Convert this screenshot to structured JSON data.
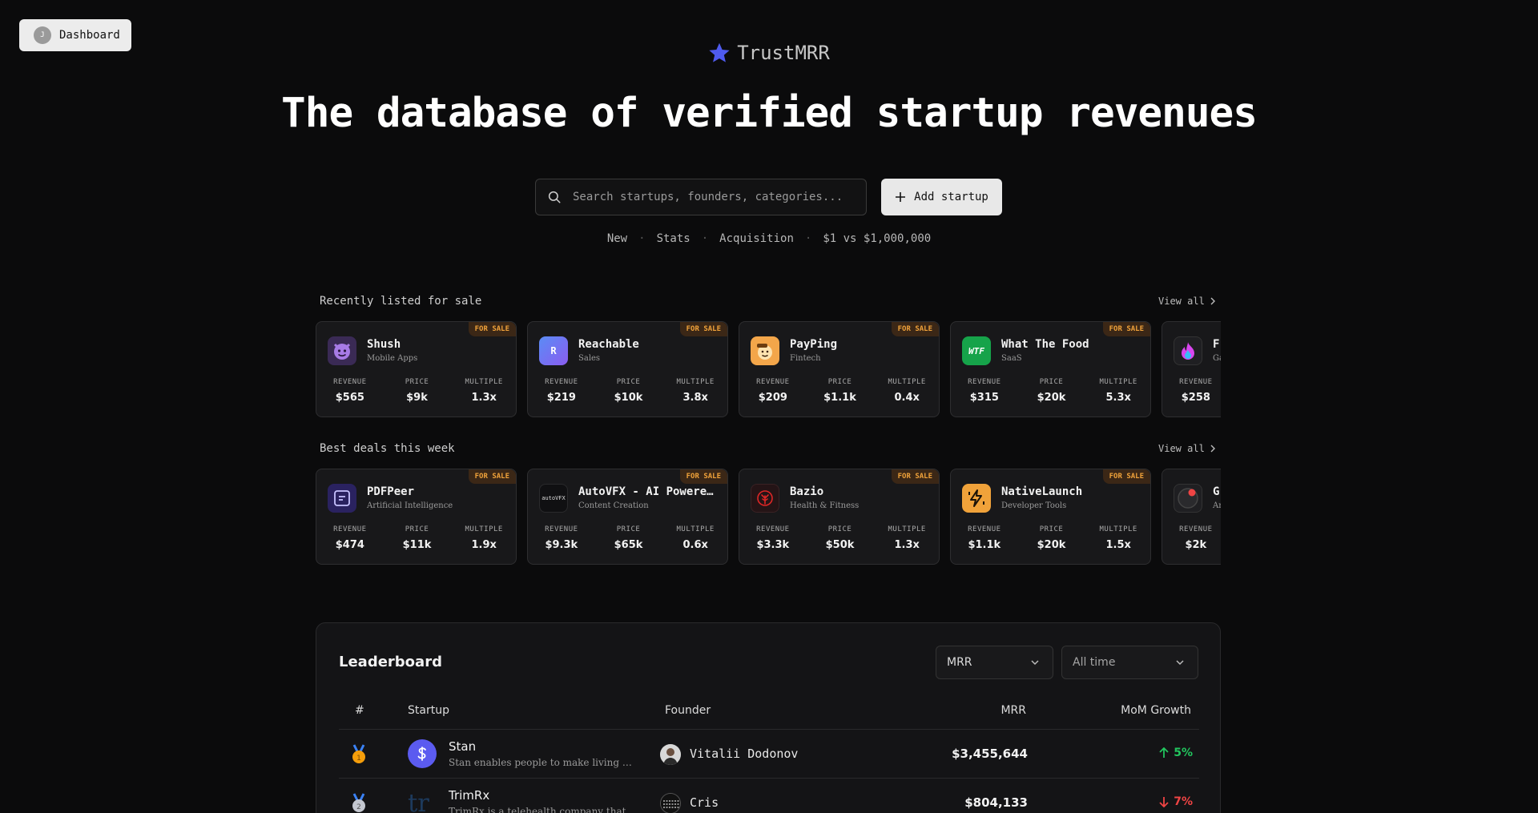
{
  "nav": {
    "dashboard_label": "Dashboard",
    "avatar_initial": "J"
  },
  "brand": {
    "name": "TrustMRR",
    "accent": "#4f5bef"
  },
  "hero": {
    "title": "The database of verified startup revenues"
  },
  "search": {
    "placeholder": "Search startups, founders, categories..."
  },
  "add_startup_label": "Add startup",
  "links": [
    "New",
    "Stats",
    "Acquisition",
    "$1 vs $1,000,000"
  ],
  "recent": {
    "title": "Recently listed for sale",
    "view_all": "View all",
    "cards": [
      {
        "name": "Shush",
        "category": "Mobile Apps",
        "badge": "FOR SALE",
        "revenue": "$565",
        "price": "$9k",
        "multiple": "1.3x",
        "logo_icon": "devil-emoji-icon",
        "logo_color": "#3a2a55"
      },
      {
        "name": "Reachable",
        "category": "Sales",
        "badge": "FOR SALE",
        "revenue": "$219",
        "price": "$10k",
        "multiple": "3.8x",
        "logo_text": "R",
        "logo_color": "#6d6cf2"
      },
      {
        "name": "PayPing",
        "category": "Fintech",
        "badge": "FOR SALE",
        "revenue": "$209",
        "price": "$1.1k",
        "multiple": "0.4x",
        "logo_icon": "saluting-face-icon",
        "logo_color": "#f3a64a"
      },
      {
        "name": "What The Food",
        "category": "SaaS",
        "badge": "FOR SALE",
        "revenue": "$315",
        "price": "$20k",
        "multiple": "5.3x",
        "logo_text": "WTF",
        "logo_color": "#16a34a"
      },
      {
        "name": "F",
        "category": "Ga",
        "badge": "",
        "revenue": "$258",
        "price": "",
        "multiple": "",
        "logo_icon": "flame-icon",
        "logo_color": "#1f1f22"
      }
    ]
  },
  "deals": {
    "title": "Best deals this week",
    "view_all": "View all",
    "cards": [
      {
        "name": "PDFPeer",
        "category": "Artificial Intelligence",
        "badge": "FOR SALE",
        "revenue": "$474",
        "price": "$11k",
        "multiple": "1.9x",
        "logo_icon": "document-icon",
        "logo_color": "#2a2260"
      },
      {
        "name": "AutoVFX - AI Powered…",
        "category": "Content Creation",
        "badge": "FOR SALE",
        "revenue": "$9.3k",
        "price": "$65k",
        "multiple": "0.6x",
        "logo_text": "autoVFX",
        "logo_color": "#101012"
      },
      {
        "name": "Bazio",
        "category": "Health & Fitness",
        "badge": "FOR SALE",
        "revenue": "$3.3k",
        "price": "$50k",
        "multiple": "1.3x",
        "logo_icon": "leaf-icon",
        "logo_color": "#241416"
      },
      {
        "name": "NativeLaunch",
        "category": "Developer Tools",
        "badge": "FOR SALE",
        "revenue": "$1.1k",
        "price": "$20k",
        "multiple": "1.5x",
        "logo_icon": "lightning-icon",
        "logo_color": "#f0a23a"
      },
      {
        "name": "G",
        "category": "Ar",
        "badge": "",
        "revenue": "$2k",
        "price": "",
        "multiple": "",
        "logo_icon": "record-icon",
        "logo_color": "#1f1f22"
      }
    ]
  },
  "metric_labels": {
    "revenue": "REVENUE",
    "price": "PRICE",
    "multiple": "MULTIPLE"
  },
  "leaderboard": {
    "title": "Leaderboard",
    "metric_select": "MRR",
    "period_select": "All time",
    "columns": {
      "rank": "#",
      "startup": "Startup",
      "founder": "Founder",
      "mrr": "MRR",
      "growth": "MoM Growth"
    },
    "rows": [
      {
        "name": "Stan",
        "desc": "Stan enables people to make living …",
        "founder": "Vitalii Dodonov",
        "mrr": "$3,455,644",
        "growth": "5%",
        "direction": "up",
        "medal": "gold-medal-icon"
      },
      {
        "name": "TrimRx",
        "desc": "TrimRx is a telehealth company that…",
        "founder": "Cris",
        "mrr": "$804,133",
        "growth": "7%",
        "direction": "down",
        "medal": "silver-medal-icon"
      }
    ]
  },
  "colors": {
    "up": "#22c55e",
    "down": "#ef4444",
    "badge_text": "#f0a23a"
  }
}
